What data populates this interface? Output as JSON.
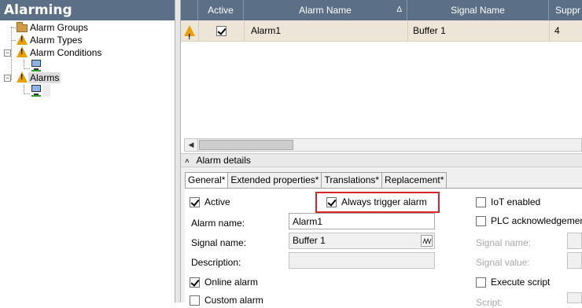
{
  "tree": {
    "title": "Alarming",
    "items": [
      {
        "label": "Alarm Groups",
        "icon": "folder-icon"
      },
      {
        "label": "Alarm Types",
        "icon": "warning-icon"
      },
      {
        "label": "Alarm Conditions",
        "icon": "warning-icon"
      },
      {
        "label": "",
        "icon": "computer-icon"
      },
      {
        "label": "Alarms",
        "icon": "warning-icon",
        "selected": true
      },
      {
        "label": "",
        "icon": "computer-icon"
      }
    ]
  },
  "grid": {
    "columns": [
      "Active",
      "Alarm Name",
      "Signal Name",
      "Suppr"
    ],
    "sort_indicator": "Δ",
    "rows": [
      {
        "active": true,
        "alarm_name": "Alarm1",
        "signal_name": "Buffer 1",
        "suppress": "4"
      }
    ]
  },
  "details": {
    "header": "Alarm details",
    "collapse_glyph": "˄",
    "tabs": [
      "General*",
      "Extended properties*",
      "Translations*",
      "Replacement*"
    ],
    "active_tab": 0,
    "general": {
      "active_label": "Active",
      "active_checked": true,
      "always_trigger_label": "Always trigger alarm",
      "always_trigger_checked": true,
      "iot_label": "IoT enabled",
      "iot_checked": false,
      "plc_ack_label": "PLC acknowledgement",
      "plc_ack_checked": false,
      "alarm_name_label": "Alarm name:",
      "alarm_name_value": "Alarm1",
      "signal_name_label": "Signal name:",
      "signal_name_value": "Buffer 1",
      "description_label": "Description:",
      "description_value": "",
      "right_signal_name_label": "Signal name:",
      "right_signal_value_label": "Signal value:",
      "online_alarm_label": "Online alarm",
      "online_alarm_checked": true,
      "execute_script_label": "Execute script",
      "execute_script_checked": false,
      "custom_alarm_label": "Custom alarm",
      "custom_alarm_checked": false,
      "script_label": "Script:"
    }
  },
  "colors": {
    "header_bg": "#5b6f86",
    "row_bg": "#ece5d8",
    "highlight": "#d9242a",
    "warning": "#e8a000"
  }
}
